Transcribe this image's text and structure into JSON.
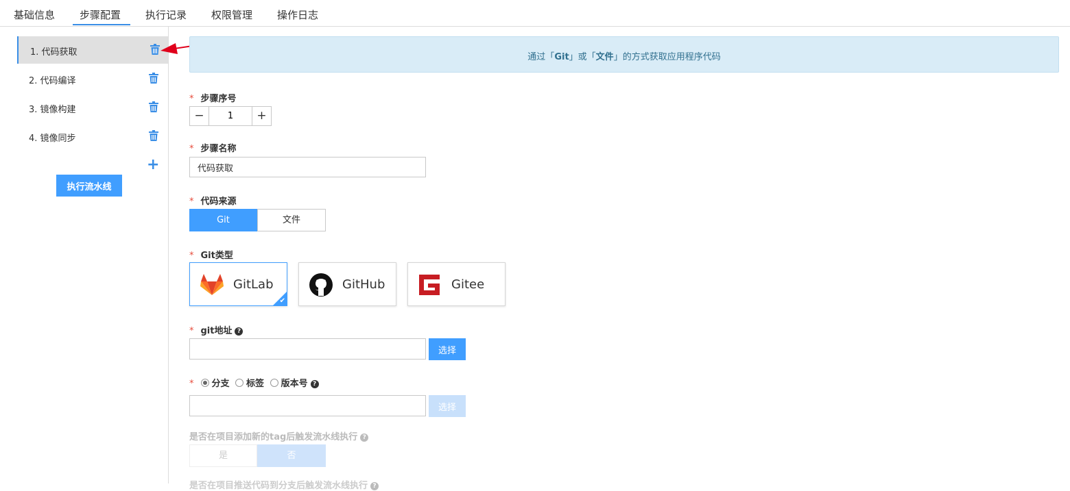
{
  "tabs": [
    {
      "label": "基础信息"
    },
    {
      "label": "步骤配置"
    },
    {
      "label": "执行记录"
    },
    {
      "label": "权限管理"
    },
    {
      "label": "操作日志"
    }
  ],
  "active_tab": "步骤配置",
  "sidebar": {
    "steps": [
      {
        "label": "1. 代码获取"
      },
      {
        "label": "2. 代码编译"
      },
      {
        "label": "3. 镜像构建"
      },
      {
        "label": "4. 镜像同步"
      }
    ],
    "add_label": "+",
    "run_button": "执行流水线"
  },
  "banner": {
    "prefix": "通过「",
    "git": "Git",
    "mid": "」或「",
    "file": "文件",
    "suffix": "」的方式获取应用程序代码"
  },
  "form": {
    "required_mark": "*",
    "step_no": {
      "label": "步骤序号",
      "value": "1",
      "minus": "−",
      "plus": "+"
    },
    "step_name": {
      "label": "步骤名称",
      "value": "代码获取"
    },
    "code_source": {
      "label": "代码来源",
      "options": [
        "Git",
        "文件"
      ],
      "selected": "Git"
    },
    "git_type": {
      "label": "Git类型",
      "options": [
        "GitLab",
        "GitHub",
        "Gitee"
      ],
      "selected": "GitLab"
    },
    "git_url": {
      "label": "git地址",
      "value": "",
      "select_button": "选择"
    },
    "ref_type": {
      "options": [
        "分支",
        "标签",
        "版本号"
      ],
      "selected": "分支",
      "value": "",
      "select_button": "选择"
    },
    "tag_trigger": {
      "label": "是否在项目添加新的tag后触发流水线执行",
      "options": [
        "是",
        "否"
      ],
      "selected": "否"
    },
    "push_trigger": {
      "label": "是否在项目推送代码到分支后触发流水线执行"
    }
  },
  "colors": {
    "accent": "#409eff",
    "banner_bg": "#d9ecf7",
    "required": "#e74c3c",
    "arrow": "#e0001b"
  }
}
